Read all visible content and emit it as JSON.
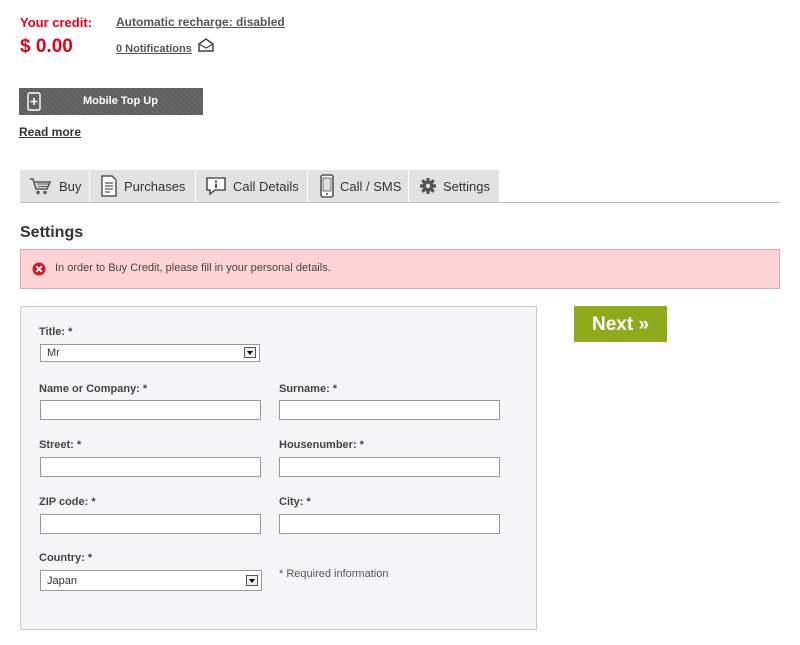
{
  "credit": {
    "label": "Your credit:",
    "amount": "$ 0.00"
  },
  "links": {
    "recharge": "Automatic recharge: disabled",
    "notifications": "0 Notifications",
    "read_more": "Read more"
  },
  "topup": {
    "label": "Mobile Top Up"
  },
  "tabs": [
    {
      "label": "Buy",
      "icon": "cart-icon"
    },
    {
      "label": "Purchases",
      "icon": "document-icon"
    },
    {
      "label": "Call Details",
      "icon": "info-icon"
    },
    {
      "label": "Call / SMS",
      "icon": "phone-icon"
    },
    {
      "label": "Settings",
      "icon": "gear-icon"
    }
  ],
  "page_title": "Settings",
  "alert": {
    "message": "In order to Buy Credit, please fill in your personal details.",
    "color": "#fdd3d5"
  },
  "form": {
    "title_label": "Title: *",
    "title_value": "Mr",
    "name_label": "Name or Company: *",
    "name_value": "",
    "surname_label": "Surname: *",
    "surname_value": "",
    "street_label": "Street: *",
    "street_value": "",
    "housenumber_label": "Housenumber: *",
    "housenumber_value": "",
    "zip_label": "ZIP code: *",
    "zip_value": "",
    "city_label": "City: *",
    "city_value": "",
    "country_label": "Country: *",
    "country_value": "Japan",
    "required_note": "* Required information"
  },
  "next_button": {
    "label": "Next »",
    "color": "#8eaa1a"
  },
  "colors": {
    "accent_red": "#e2001a",
    "tab_bg": "#e2e2e2"
  }
}
